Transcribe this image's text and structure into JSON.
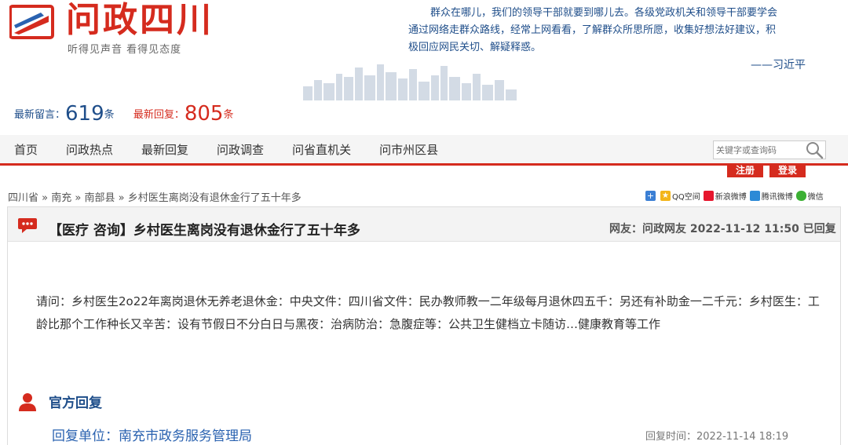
{
  "header": {
    "logo_title": "问政四川",
    "logo_slogan": "听得见声音  看得见态度",
    "quote_lines": [
      "群众在哪儿，我们的领导干部就要到哪儿去。各级党政机关和领导干部要学会",
      "通过网络走群众路线，经常上网看看，了解群众所思所愿，收集好想法好建议，积",
      "极回应网民关切、解疑释惑。"
    ],
    "quote_author": "——习近平",
    "brand_color": "#d52b1e"
  },
  "stats": {
    "new_messages_label": "最新留言：",
    "new_messages_count": "619",
    "new_messages_unit": "条",
    "new_replies_label": "最新回复：",
    "new_replies_count": "805",
    "new_replies_unit": "条"
  },
  "nav": {
    "items": [
      {
        "label": "首页"
      },
      {
        "label": "问政热点"
      },
      {
        "label": "最新回复"
      },
      {
        "label": "问政调查"
      },
      {
        "label": "问省直机关"
      },
      {
        "label": "问市州区县"
      }
    ],
    "search_placeholder": "关键字或查询码",
    "register_label": "注册",
    "login_label": "登录"
  },
  "breadcrumb": {
    "items": [
      "四川省",
      "南充",
      "南部县",
      "乡村医生离岗没有退休金行了五十年多"
    ],
    "separator": " » "
  },
  "share": {
    "items": [
      {
        "label": "",
        "icon": "plus-icon",
        "color": "#3b7fd4"
      },
      {
        "label": "QQ空间",
        "icon": "qzone-icon",
        "color": "#f3b51a"
      },
      {
        "label": "新浪微博",
        "icon": "weibo-icon",
        "color": "#e6162d"
      },
      {
        "label": "腾讯微博",
        "icon": "tencent-weibo-icon",
        "color": "#2d8ad6"
      },
      {
        "label": "微信",
        "icon": "wechat-icon",
        "color": "#3cb034"
      }
    ]
  },
  "post": {
    "title": "【医疗 咨询】乡村医生离岗没有退休金行了五十年多",
    "meta": "网友：问政网友  2022-11-12 11:50 已回复",
    "body": "请问：乡村医生2o22年离岗退休无养老退休金：中央文件：四川省文件：民办教师教一二年级每月退休四五千：另还有补助金一二千元：乡村医生：工龄比那个工作种长又辛苦：设有节假日不分白日与黑夜：治病防治：急腹症等：公共卫生健档立卡随访…健康教育等工作"
  },
  "reply": {
    "heading": "官方回复",
    "unit": "回复单位：南充市政务服务管理局",
    "time": "回复时间：2022-11-14 18:19"
  }
}
